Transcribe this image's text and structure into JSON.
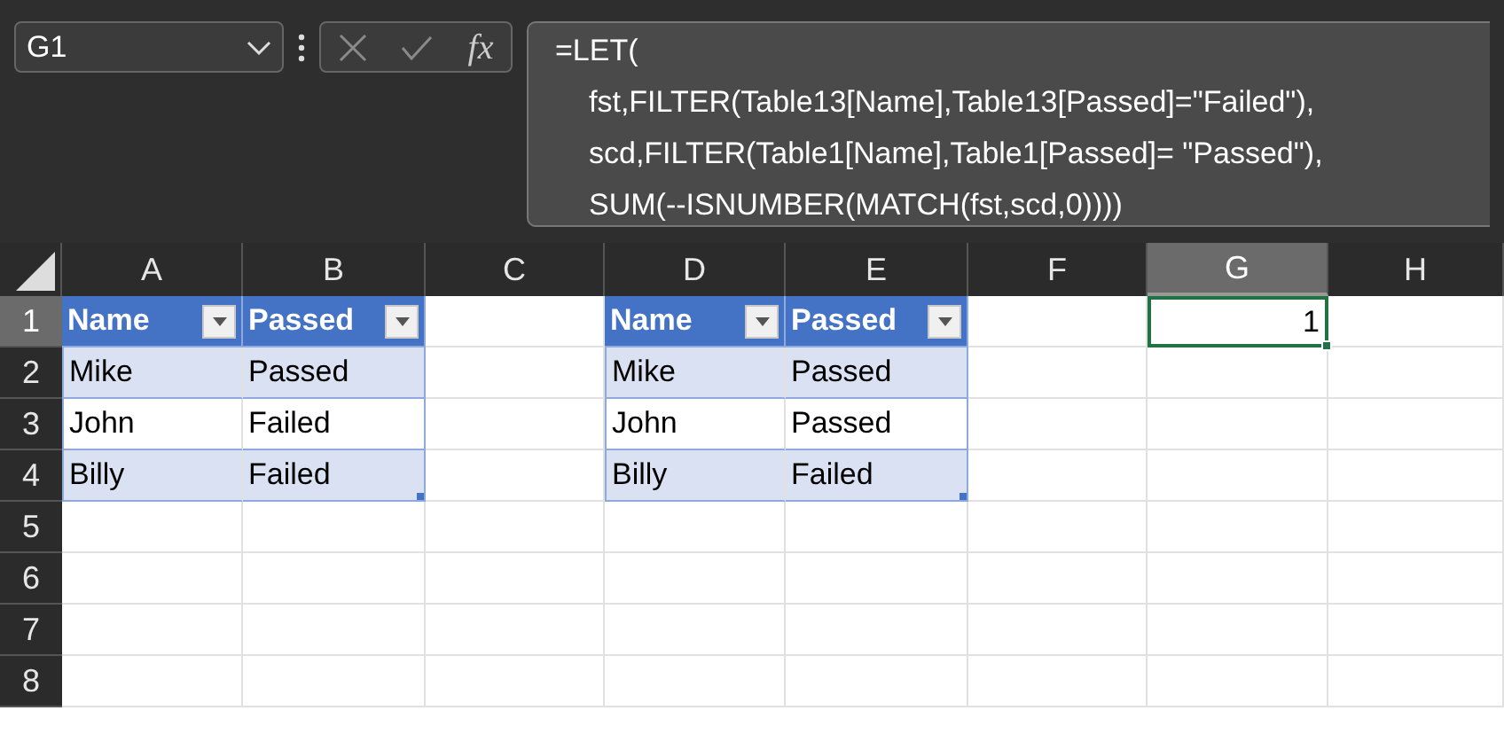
{
  "name_box": {
    "value": "G1"
  },
  "function_button": "fx",
  "formula_lines": [
    "=LET(",
    "fst,FILTER(Table13[Name],Table13[Passed]=\"Failed\"),",
    "scd,FILTER(Table1[Name],Table1[Passed]= \"Passed\"),",
    "SUM(--ISNUMBER(MATCH(fst,scd,0))))"
  ],
  "columns": [
    {
      "label": "A",
      "selected": false
    },
    {
      "label": "B",
      "selected": false
    },
    {
      "label": "C",
      "selected": false
    },
    {
      "label": "D",
      "selected": false
    },
    {
      "label": "E",
      "selected": false
    },
    {
      "label": "F",
      "selected": false
    },
    {
      "label": "G",
      "selected": true
    },
    {
      "label": "H",
      "selected": false
    }
  ],
  "rows": [
    {
      "label": "1",
      "selected": true,
      "cells": [
        {
          "kind": "header",
          "text": "Name"
        },
        {
          "kind": "header",
          "text": "Passed"
        },
        null,
        {
          "kind": "header",
          "text": "Name"
        },
        {
          "kind": "header",
          "text": "Passed"
        },
        null,
        {
          "kind": "value",
          "text": "1",
          "selected": true
        },
        null
      ]
    },
    {
      "label": "2",
      "selected": false,
      "cells": [
        {
          "kind": "band",
          "text": "Mike"
        },
        {
          "kind": "band",
          "text": "Passed"
        },
        null,
        {
          "kind": "band",
          "text": "Mike"
        },
        {
          "kind": "band",
          "text": "Passed"
        },
        null,
        null,
        null
      ]
    },
    {
      "label": "3",
      "selected": false,
      "cells": [
        {
          "kind": "plain",
          "text": "John"
        },
        {
          "kind": "plain",
          "text": "Failed"
        },
        null,
        {
          "kind": "plain",
          "text": "John"
        },
        {
          "kind": "plain",
          "text": "Passed"
        },
        null,
        null,
        null
      ]
    },
    {
      "label": "4",
      "selected": false,
      "cells": [
        {
          "kind": "band",
          "text": "Billy"
        },
        {
          "kind": "band",
          "text": "Failed"
        },
        null,
        {
          "kind": "band",
          "text": "Billy"
        },
        {
          "kind": "band",
          "text": "Failed"
        },
        null,
        null,
        null
      ]
    },
    {
      "label": "5",
      "selected": false,
      "cells": [
        null,
        null,
        null,
        null,
        null,
        null,
        null,
        null
      ]
    },
    {
      "label": "6",
      "selected": false,
      "cells": [
        null,
        null,
        null,
        null,
        null,
        null,
        null,
        null
      ]
    },
    {
      "label": "7",
      "selected": false,
      "cells": [
        null,
        null,
        null,
        null,
        null,
        null,
        null,
        null
      ]
    },
    {
      "label": "8",
      "selected": false,
      "cells": [
        null,
        null,
        null,
        null,
        null,
        null,
        null,
        null
      ]
    }
  ]
}
